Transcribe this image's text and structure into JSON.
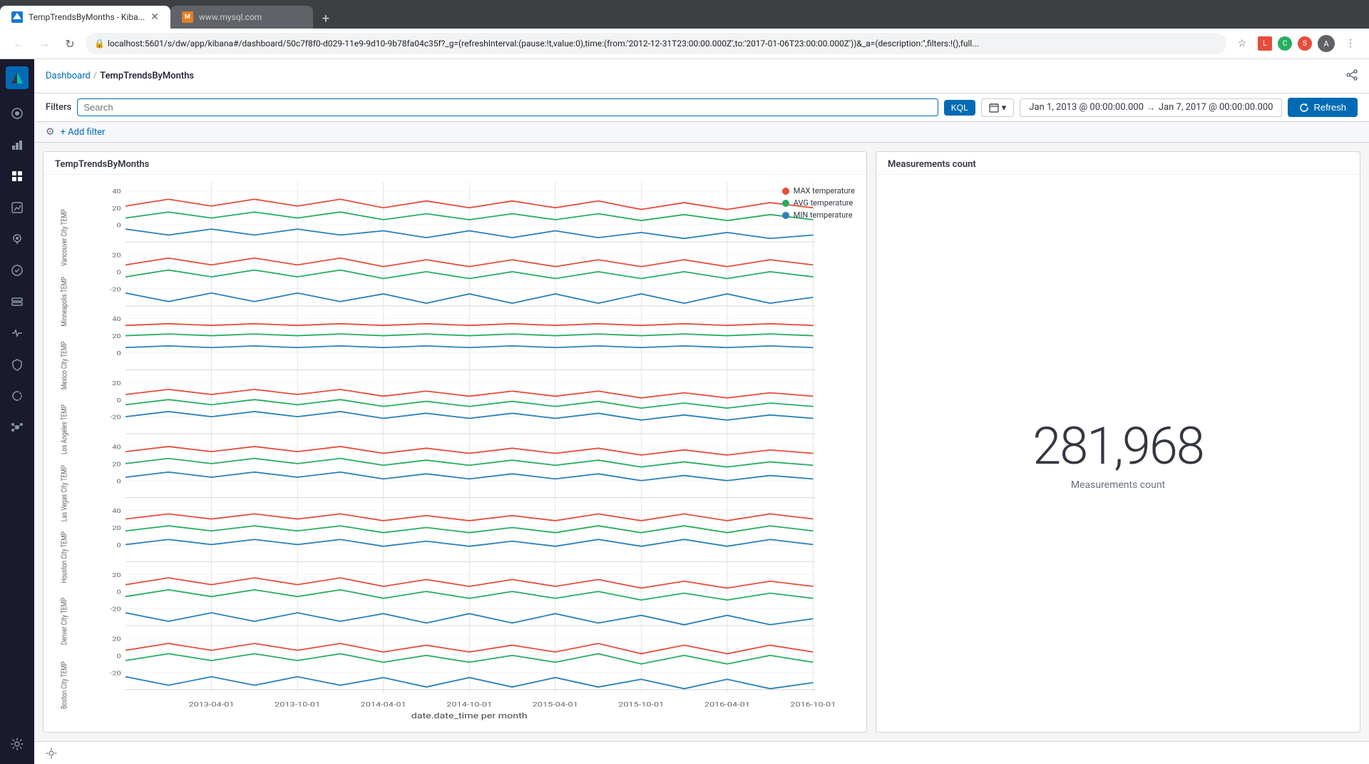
{
  "browser": {
    "tabs": [
      {
        "id": "tab1",
        "title": "TempTrendsByMonths - Kiba...",
        "active": true,
        "favicon": "K"
      },
      {
        "id": "tab2",
        "title": "www.mysql.com",
        "active": false,
        "favicon": "M"
      }
    ],
    "url": "localhost:5601/s/dw/app/kibana#/dashboard/50c7f8f0-d029-11e9-9d10-9b78fa04c35f?_g=(refreshInterval:(pause:!t,value:0),time:(from:'2012-12-31T23:00:00.000Z',to:'2017-01-06T23:00:00.000Z'))&_a=(description:'',filters:!(),full...",
    "new_tab_label": "+",
    "back_label": "←",
    "forward_label": "→",
    "reload_label": "↻"
  },
  "kibana": {
    "logo_letter": "K",
    "breadcrumb": {
      "parent": "Dashboard",
      "separator": "/",
      "current": "TempTrendsByMonths"
    },
    "filter_bar": {
      "filters_label": "Filters",
      "search_placeholder": "Search",
      "kql_label": "KQL",
      "time_from": "Jan 1, 2013 @ 00:00:00.000",
      "time_to": "Jan 7, 2017 @ 00:00:00.000",
      "time_arrow": "→",
      "refresh_label": "Refresh"
    },
    "add_filter": {
      "label": "+ Add filter"
    },
    "main_panel": {
      "title": "TempTrendsByMonths",
      "legend": [
        {
          "color": "#e74c3c",
          "label": "MAX temperature"
        },
        {
          "color": "#27ae60",
          "label": "AVG temperature"
        },
        {
          "color": "#2980b9",
          "label": "MIN temperature"
        }
      ],
      "cities": [
        "Vancouver City TEMP",
        "Minneapolis TEMP",
        "Mexico City TEMP",
        "Los Angeles TEMP",
        "Las Vegas City TEMP",
        "Houston City TEMP",
        "Denver City TEMP",
        "Boston City TEMP"
      ],
      "x_axis_label": "date.date_time per month",
      "x_ticks": [
        "2013-04-01",
        "2013-10-01",
        "2014-04-01",
        "2014-10-01",
        "2015-04-01",
        "2015-10-01",
        "2016-04-01",
        "2016-10-01"
      ]
    },
    "side_panel": {
      "title": "Measurements count",
      "value": "281,968",
      "label": "Measurements count"
    }
  },
  "sidebar": {
    "items": [
      {
        "id": "discover",
        "icon": "●"
      },
      {
        "id": "visualize",
        "icon": "◑"
      },
      {
        "id": "dashboard",
        "icon": "▦"
      },
      {
        "id": "canvas",
        "icon": "⊡"
      },
      {
        "id": "maps",
        "icon": "⊕"
      },
      {
        "id": "ml",
        "icon": "⊗"
      },
      {
        "id": "infrastructure",
        "icon": "⊘"
      },
      {
        "id": "apm",
        "icon": "◌"
      },
      {
        "id": "siem",
        "icon": "⊞"
      },
      {
        "id": "uptime",
        "icon": "♡"
      },
      {
        "id": "graph",
        "icon": "◉"
      }
    ],
    "bottom_items": [
      {
        "id": "settings",
        "icon": "⚙"
      }
    ]
  },
  "colors": {
    "max_temp": "#e74c3c",
    "avg_temp": "#27ae60",
    "min_temp": "#2980b9",
    "kibana_blue": "#006bb4",
    "kibana_dark": "#1a1a2e"
  }
}
